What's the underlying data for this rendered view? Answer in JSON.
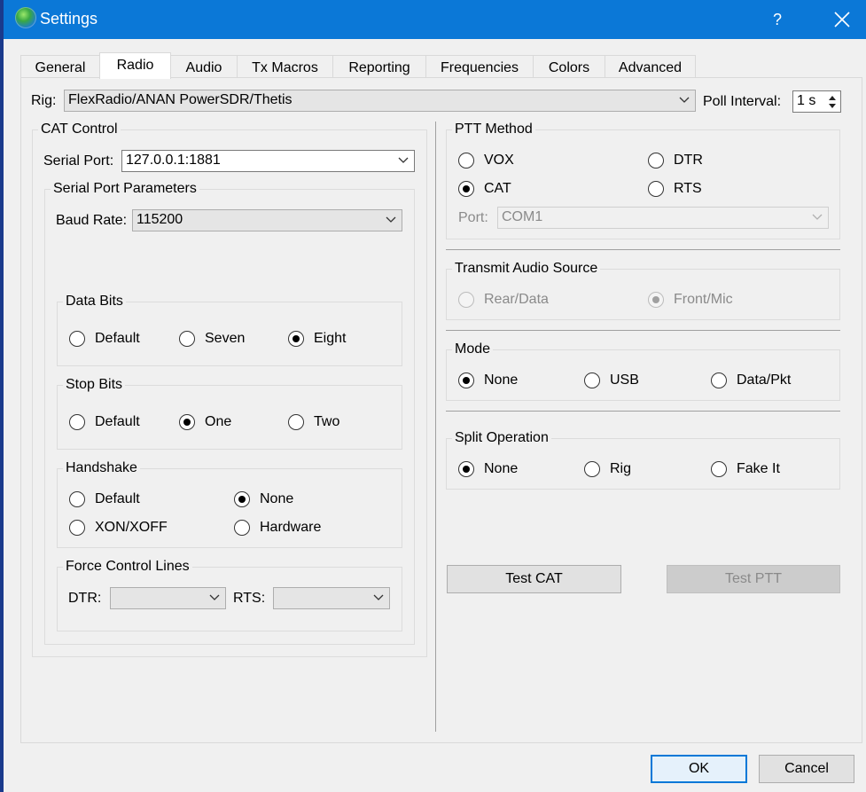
{
  "window": {
    "title": "Settings",
    "help_glyph": "?"
  },
  "tabs": [
    {
      "label": "General"
    },
    {
      "label": "Radio"
    },
    {
      "label": "Audio"
    },
    {
      "label": "Tx Macros"
    },
    {
      "label": "Reporting"
    },
    {
      "label": "Frequencies"
    },
    {
      "label": "Colors"
    },
    {
      "label": "Advanced"
    }
  ],
  "active_tab": "Radio",
  "rig": {
    "label": "Rig:",
    "value": "FlexRadio/ANAN PowerSDR/Thetis"
  },
  "poll": {
    "label": "Poll Interval:",
    "value": "1 s"
  },
  "cat": {
    "title": "CAT Control",
    "serial_port_label": "Serial Port:",
    "serial_port_value": "127.0.0.1:1881",
    "params_title": "Serial Port Parameters",
    "baud_label": "Baud Rate:",
    "baud_value": "115200",
    "data_bits": {
      "title": "Data Bits",
      "options": [
        "Default",
        "Seven",
        "Eight"
      ],
      "selected": "Eight"
    },
    "stop_bits": {
      "title": "Stop Bits",
      "options": [
        "Default",
        "One",
        "Two"
      ],
      "selected": "One"
    },
    "handshake": {
      "title": "Handshake",
      "options": [
        "Default",
        "None",
        "XON/XOFF",
        "Hardware"
      ],
      "selected": "None"
    },
    "force": {
      "title": "Force Control Lines",
      "dtr_label": "DTR:",
      "rts_label": "RTS:",
      "dtr_value": "",
      "rts_value": ""
    }
  },
  "ptt": {
    "title": "PTT Method",
    "options": [
      "VOX",
      "DTR",
      "CAT",
      "RTS"
    ],
    "selected": "CAT",
    "port_label": "Port:",
    "port_value": "COM1"
  },
  "tx_audio": {
    "title": "Transmit Audio Source",
    "options": [
      "Rear/Data",
      "Front/Mic"
    ],
    "selected": "Front/Mic"
  },
  "mode": {
    "title": "Mode",
    "options": [
      "None",
      "USB",
      "Data/Pkt"
    ],
    "selected": "None"
  },
  "split": {
    "title": "Split Operation",
    "options": [
      "None",
      "Rig",
      "Fake It"
    ],
    "selected": "None"
  },
  "buttons": {
    "test_cat": "Test CAT",
    "test_ptt": "Test PTT",
    "ok": "OK",
    "cancel": "Cancel"
  }
}
